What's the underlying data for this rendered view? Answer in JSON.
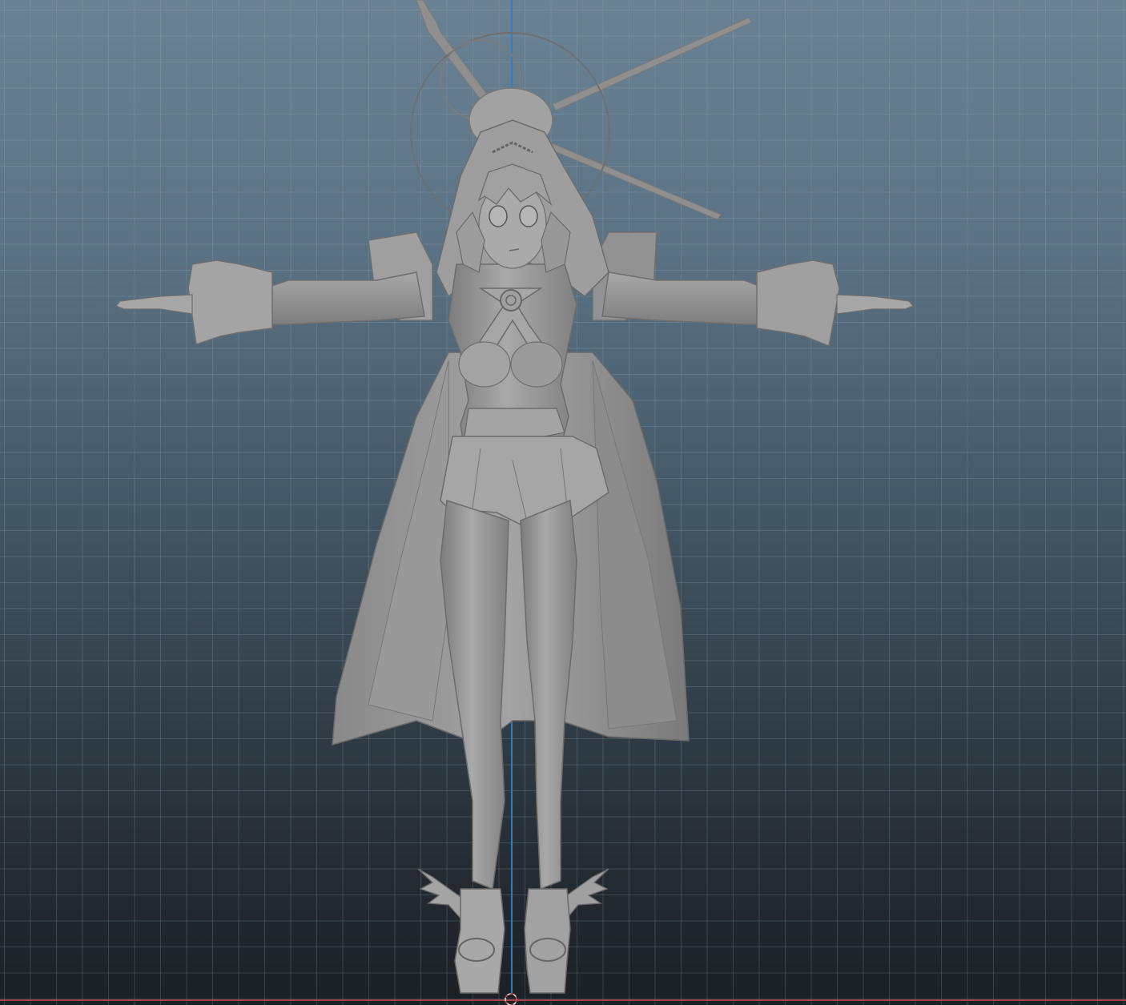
{
  "viewport": {
    "view": "front",
    "background_top": "#6a8294",
    "background_bottom": "#1b2024",
    "grid_color": "#a0b4c3",
    "y_axis_color": "#2f7fc0",
    "x_axis_color": "#a04040"
  },
  "model": {
    "shading": "gray-smooth",
    "pose": "t-pose",
    "base_color": "#9c9c9c"
  }
}
